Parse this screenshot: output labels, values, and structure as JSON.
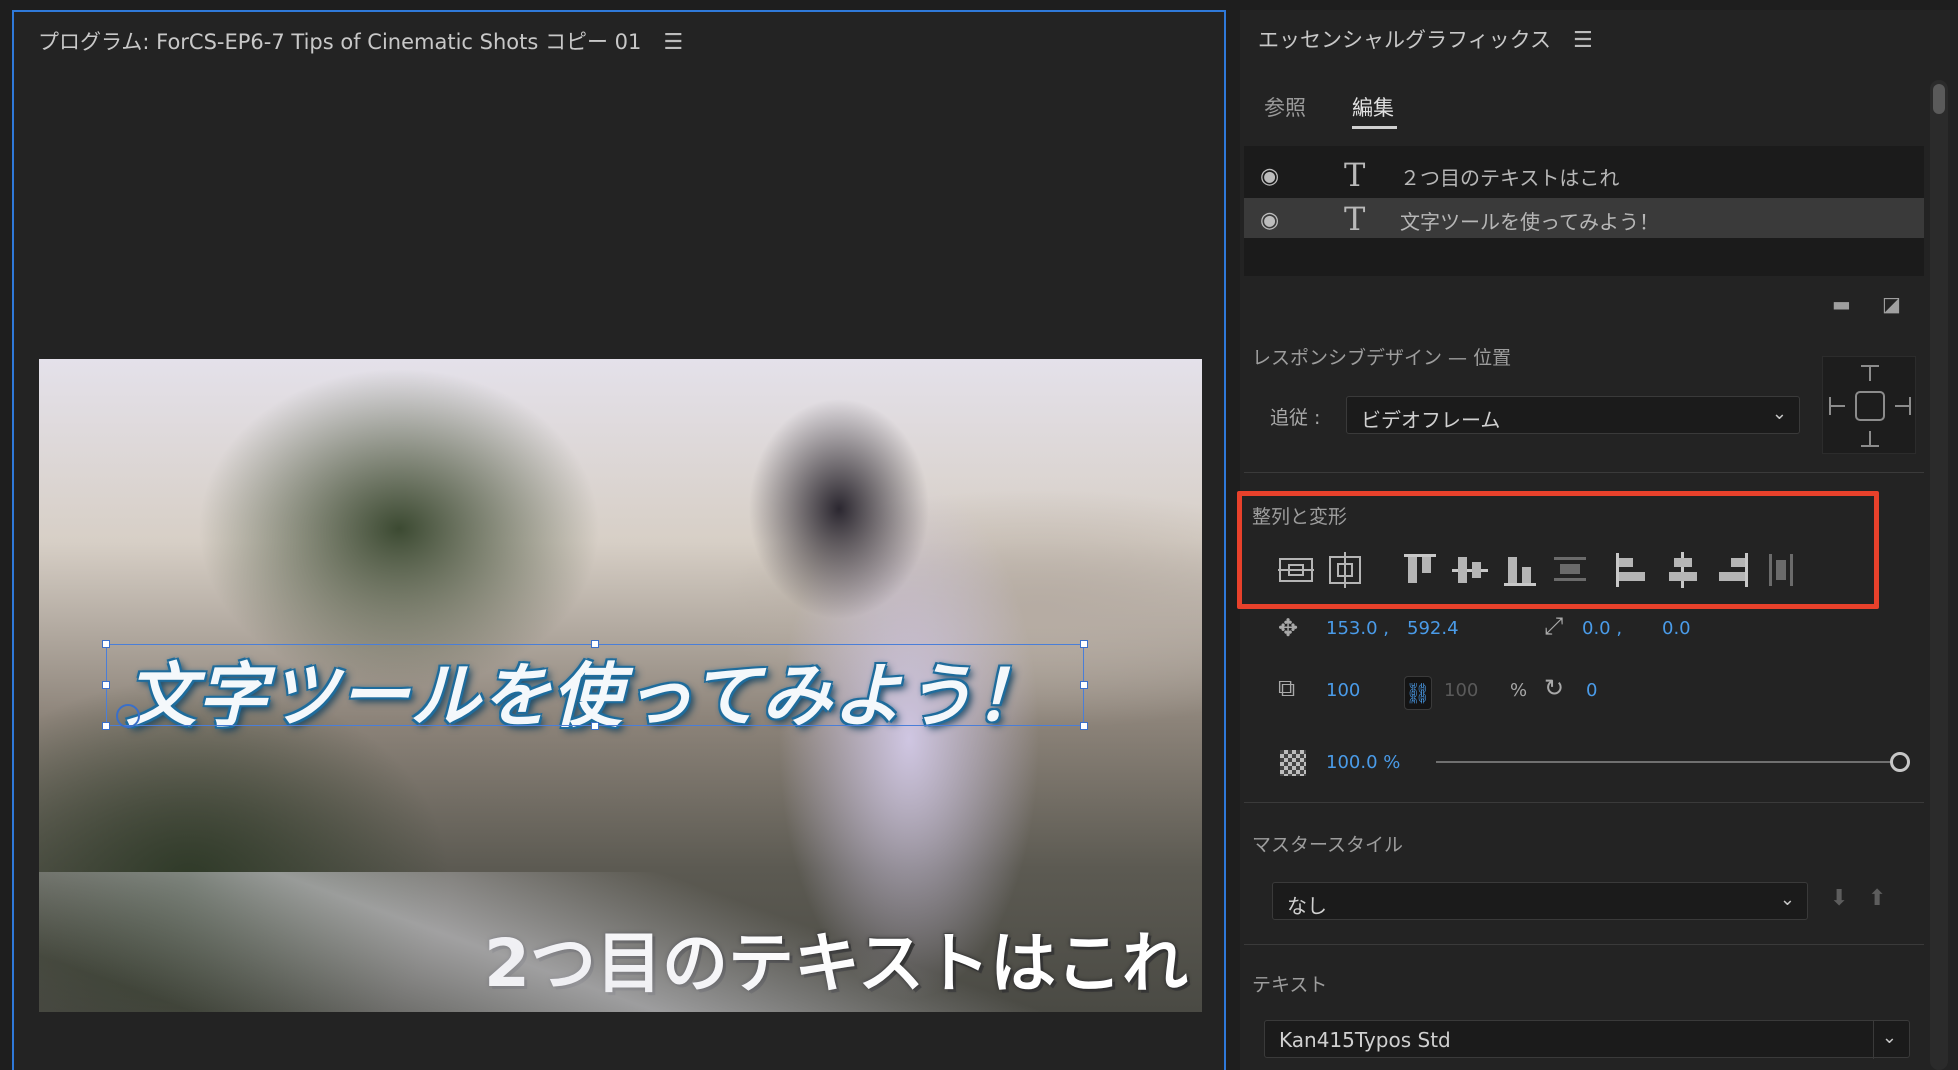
{
  "program": {
    "title": "プログラム: ForCS-EP6-7 Tips of Cinematic Shots コピー 01",
    "menu_icon": "hamburger-icon",
    "video": {
      "title1": "文字ツールを使ってみよう！",
      "title2": "2つ目のテキストはこれ"
    }
  },
  "panel": {
    "title": "エッセンシャルグラフィックス",
    "menu_icon": "hamburger-icon",
    "tabs": {
      "browse": "参照",
      "edit": "編集"
    },
    "layers": [
      {
        "name": "２つ目のテキストはこれ",
        "selected": false
      },
      {
        "name": "文字ツールを使ってみよう！",
        "selected": true
      }
    ],
    "responsive": {
      "title": "レスポンシブデザイン — 位置",
      "follow_label": "追従 :",
      "follow_value": "ビデオフレーム"
    },
    "align": {
      "title": "整列と変形",
      "position_x": "153.0 ,",
      "position_y": "592.4",
      "anchor_x": "0.0 ,",
      "anchor_y": "0.0",
      "scale": "100",
      "scale_height": "100",
      "scale_unit": "%",
      "rotation": "0",
      "opacity": "100.0 %",
      "opacity_level": 1.0
    },
    "master_style": {
      "title": "マスタースタイル",
      "value": "なし"
    },
    "text": {
      "title": "テキスト",
      "font": "Kan415Typos Std"
    },
    "highlight_color": "#e8412b",
    "accent_color": "#4a9be8"
  }
}
